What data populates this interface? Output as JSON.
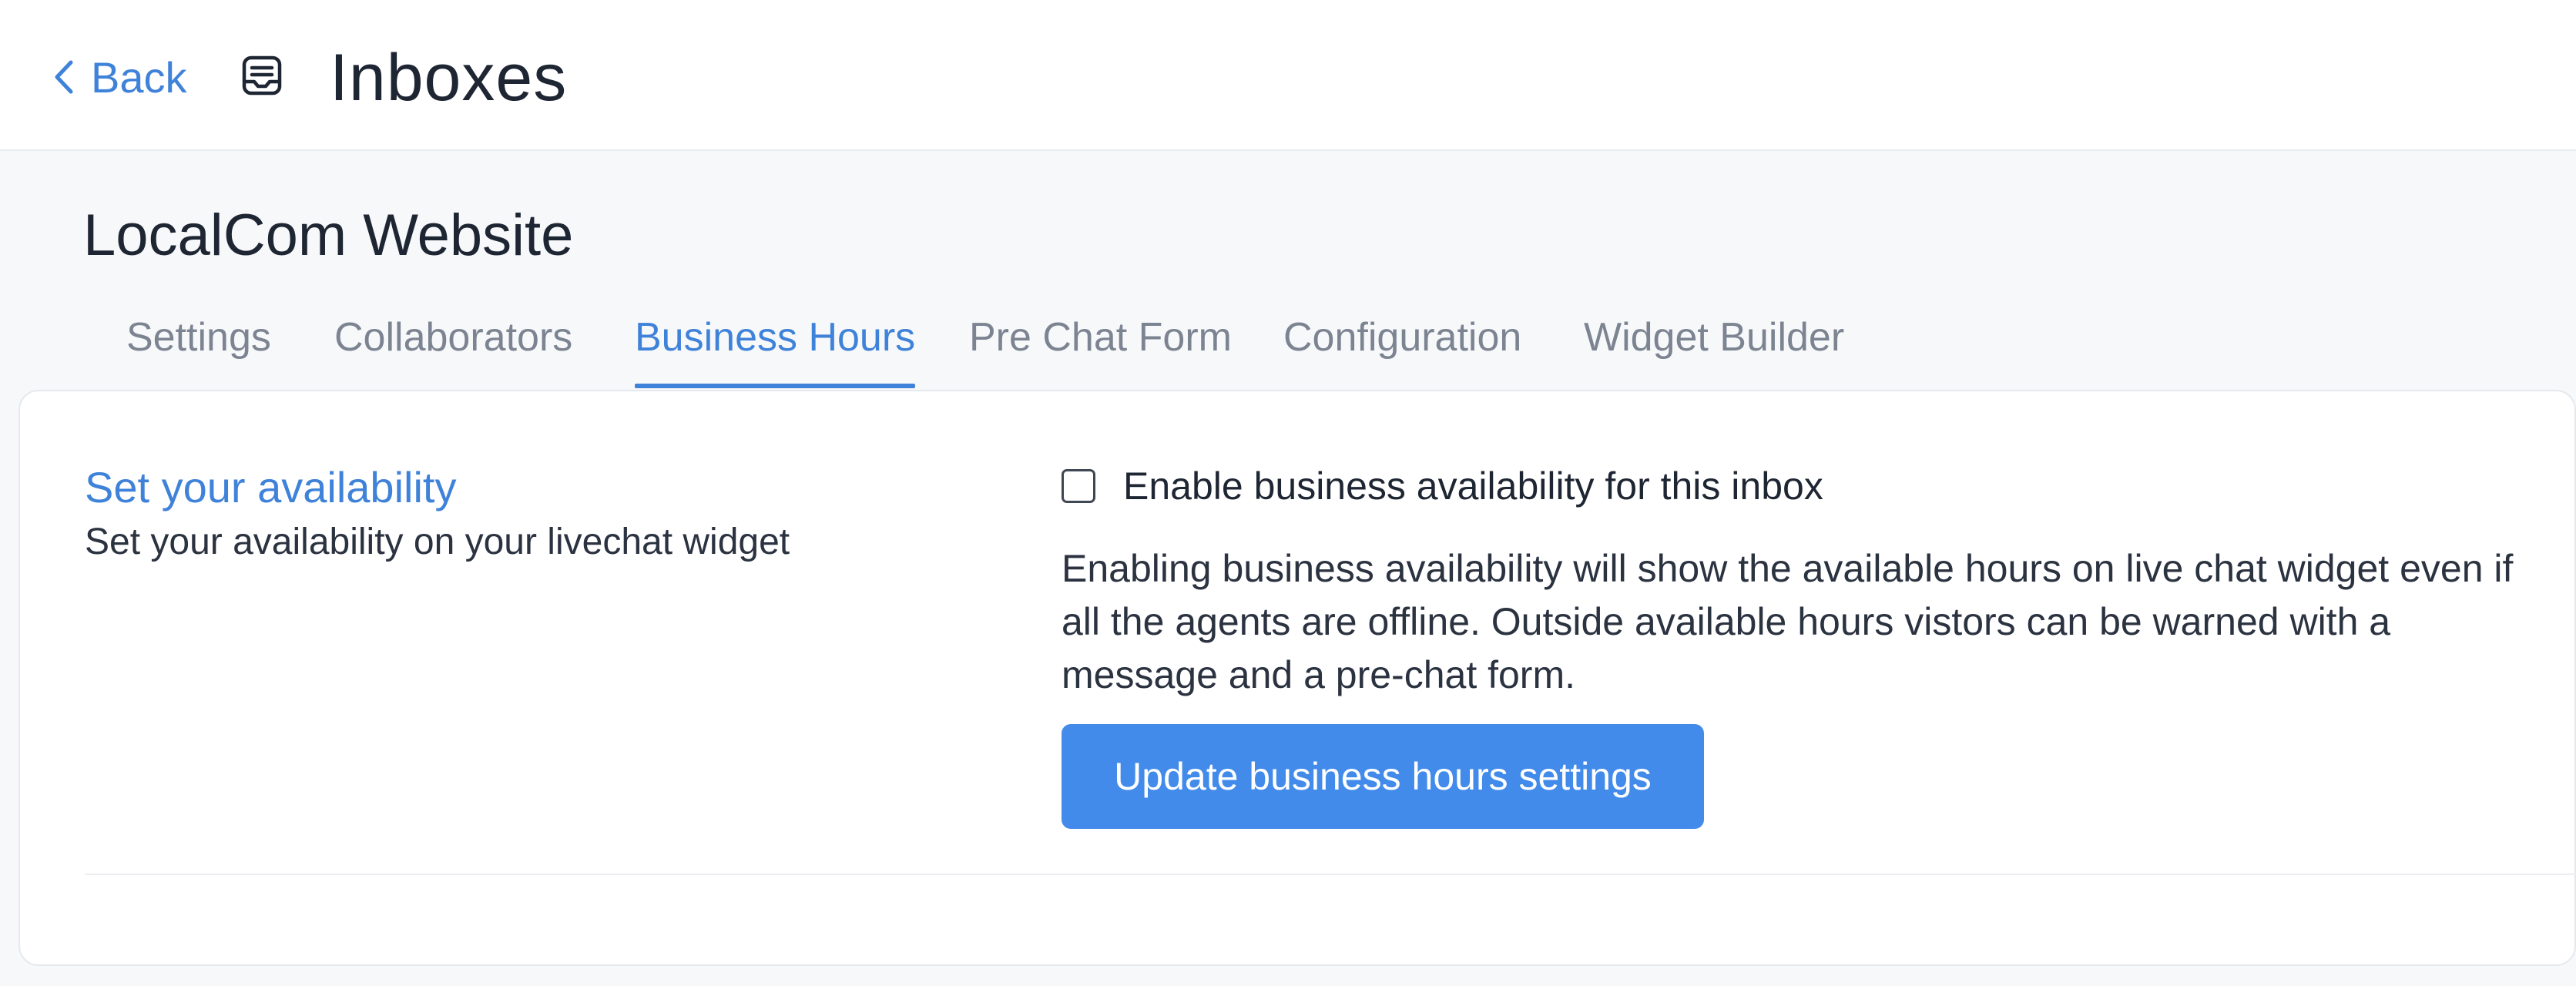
{
  "header": {
    "back_label": "Back",
    "title": "Inboxes"
  },
  "inbox": {
    "name": "LocalCom Website"
  },
  "tabs": [
    {
      "label": "Settings",
      "active": false
    },
    {
      "label": "Collaborators",
      "active": false
    },
    {
      "label": "Business Hours",
      "active": true
    },
    {
      "label": "Pre Chat Form",
      "active": false
    },
    {
      "label": "Configuration",
      "active": false
    },
    {
      "label": "Widget Builder",
      "active": false
    }
  ],
  "availability": {
    "title": "Set your availability",
    "description": "Set your availability on your livechat widget",
    "checkbox_label": "Enable business availability for this inbox",
    "checkbox_checked": false,
    "help_text": "Enabling business availability will show the available hours on live chat widget even if all the agents are offline. Outside available hours vistors can be warned with a message and a pre-chat form.",
    "button_label": "Update business hours settings"
  },
  "colors": {
    "accent": "#3f82d9",
    "button": "#428bea",
    "background": "#f7f8fa"
  },
  "icons": {
    "back": "chevron-left-icon",
    "inbox": "inbox-icon"
  }
}
